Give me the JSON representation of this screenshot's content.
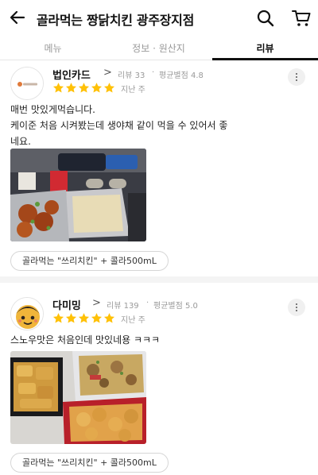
{
  "header": {
    "title": "골라먹는 짱닭치킨 광주장지점",
    "back_icon": "arrow-left-icon",
    "search_icon": "search-icon",
    "cart_icon": "cart-icon"
  },
  "tabs": [
    {
      "label": "메뉴",
      "active": false
    },
    {
      "label": "정보 · 원산지",
      "active": false
    },
    {
      "label": "리뷰",
      "active": true
    }
  ],
  "reviews": [
    {
      "nickname": "법인카드",
      "arrow": ">",
      "review_count": "리뷰 33",
      "avg_rating": "평균별점 4.8",
      "rating": 5,
      "date": "지난 주",
      "text_lines": [
        "매번 맛있게먹습니다.",
        "케이준 처음 시켜봤는데 생야채 같이 먹을 수 있어서 좋",
        "네요."
      ],
      "menu_tag": "골라먹는 \"쓰리치킨\" + 콜라500mL"
    },
    {
      "nickname": "다미밍",
      "arrow": ">",
      "review_count": "리뷰 139",
      "avg_rating": "평균별점 5.0",
      "rating": 5,
      "date": "지난 주",
      "text_lines": [
        "스노우맛은 처음인데 맛있네용 ㅋㅋㅋ"
      ],
      "menu_tag": "골라먹는 \"쓰리치킨\" + 콜라500mL"
    }
  ],
  "colors": {
    "star": "#ffc107",
    "active_tab": "#111111",
    "inactive_tab": "#999999",
    "meta_text": "#9a9a9a"
  }
}
